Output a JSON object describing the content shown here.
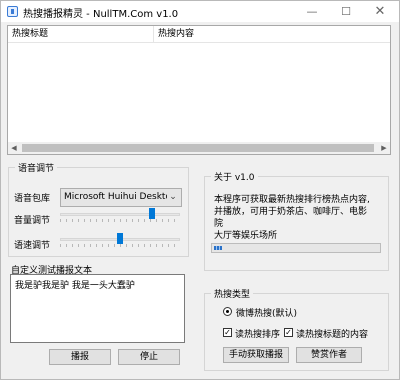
{
  "window": {
    "title": "热搜播报精灵 - NullTM.Com v1.0"
  },
  "listview": {
    "columns": [
      "热搜标题",
      "热搜内容"
    ]
  },
  "voice": {
    "group_label": "语音调节",
    "voice_label": "语音包库",
    "voice_value": "Microsoft Huihui Desktop",
    "volume_label": "音量调节",
    "volume_level": 0.78,
    "speed_label": "语速调节",
    "speed_level": 0.5
  },
  "custom": {
    "group_label": "自定义测试播报文本",
    "text": "我是驴我是驴 我是一头大蠢驴",
    "play_label": "播报",
    "stop_label": "停止"
  },
  "about": {
    "group_label": "关于 v1.0",
    "lines": [
      "本程序可获取最新热搜排行榜热点内容,",
      "并播放，可用于奶茶店、咖啡厅、电影院",
      "大厅等娱乐场所"
    ],
    "progress_fraction": 0.05
  },
  "hot": {
    "group_label": "热搜类型",
    "radio_label": "微博热搜(默认)",
    "check1_label": "读热搜排序",
    "check2_label": "读热搜标题的内容",
    "fetch_label": "手动获取播报",
    "donate_label": "赞赏作者"
  },
  "icons": {
    "minimize": "minimize-icon",
    "maximize": "maximize-icon",
    "close": "close-icon",
    "chevron": "chevron-down-icon"
  }
}
